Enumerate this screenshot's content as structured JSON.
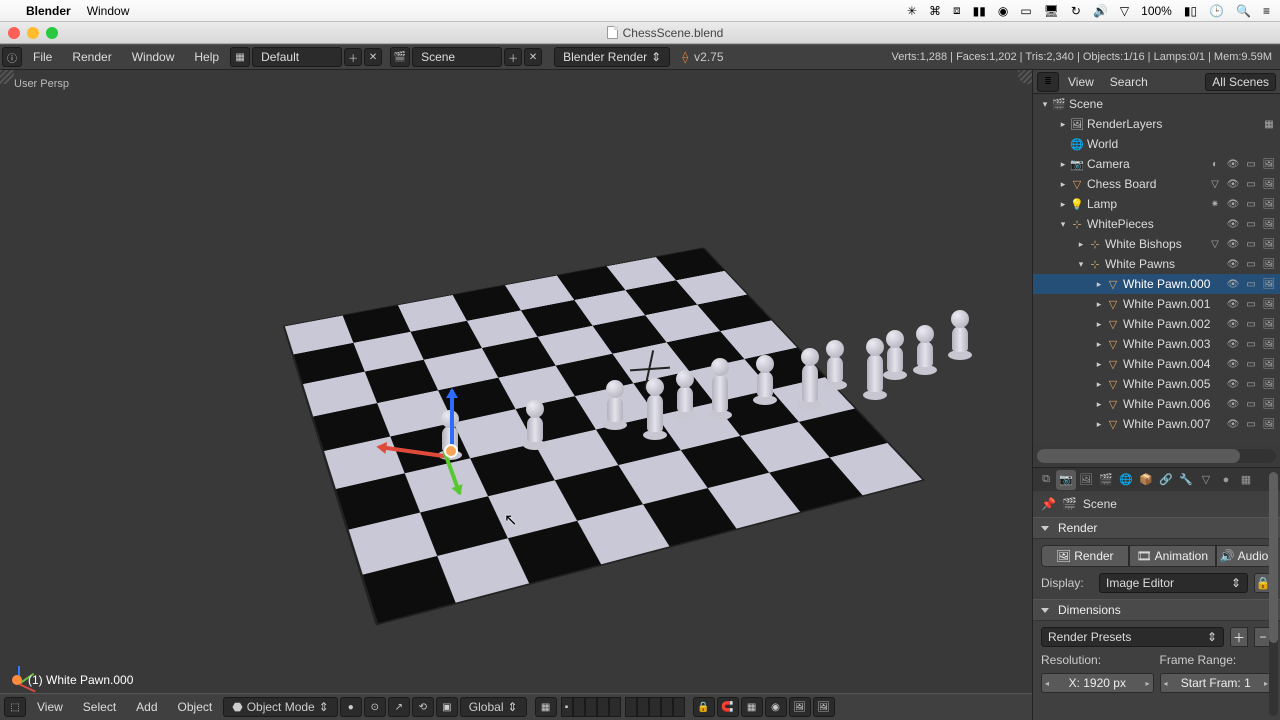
{
  "mac_menu": {
    "app": "Blender",
    "items": [
      "Window"
    ],
    "battery": "100%"
  },
  "window": {
    "title": "ChessScene.blend"
  },
  "info_bar": {
    "menus": [
      "File",
      "Render",
      "Window",
      "Help"
    ],
    "layout": "Default",
    "scene": "Scene",
    "engine": "Blender Render",
    "version": "v2.75",
    "stats": "Verts:1,288 | Faces:1,202 | Tris:2,340 | Objects:1/16 | Lamps:0/1 | Mem:9.59M"
  },
  "viewport": {
    "persp": "User Persp",
    "selected": "(1) White Pawn.000"
  },
  "v3d_header": {
    "menus": [
      "View",
      "Select",
      "Add",
      "Object"
    ],
    "mode": "Object Mode",
    "orient": "Global"
  },
  "outliner": {
    "header": {
      "view": "View",
      "search": "Search",
      "display": "All Scenes"
    },
    "tree": [
      {
        "depth": 0,
        "disc": "▾",
        "icon": "🎬",
        "cls": "i-scene",
        "name": "Scene",
        "r": []
      },
      {
        "depth": 1,
        "disc": "▸",
        "icon": "🖼",
        "cls": "i-scene",
        "name": "RenderLayers",
        "r": [
          "▦"
        ]
      },
      {
        "depth": 1,
        "disc": "",
        "icon": "🌐",
        "cls": "i-scene",
        "name": "World",
        "r": []
      },
      {
        "depth": 1,
        "disc": "▸",
        "icon": "📷",
        "cls": "i-cam",
        "name": "Camera",
        "r": [
          "◐",
          "👁",
          "▭",
          "🖼"
        ]
      },
      {
        "depth": 1,
        "disc": "▸",
        "icon": "▽",
        "cls": "i-obj",
        "name": "Chess Board",
        "r": [
          "▽",
          "👁",
          "▭",
          "🖼"
        ]
      },
      {
        "depth": 1,
        "disc": "▸",
        "icon": "💡",
        "cls": "i-lamp",
        "name": "Lamp",
        "r": [
          "✷",
          "👁",
          "▭",
          "🖼"
        ]
      },
      {
        "depth": 1,
        "disc": "▾",
        "icon": "⊹",
        "cls": "i-empty",
        "name": "WhitePieces",
        "r": [
          "👁",
          "▭",
          "🖼"
        ]
      },
      {
        "depth": 2,
        "disc": "▸",
        "icon": "⊹",
        "cls": "i-empty",
        "name": "White Bishops",
        "r": [
          "▽",
          "👁",
          "▭",
          "🖼"
        ]
      },
      {
        "depth": 2,
        "disc": "▾",
        "icon": "⊹",
        "cls": "i-empty",
        "name": "White Pawns",
        "r": [
          "👁",
          "▭",
          "🖼"
        ]
      },
      {
        "depth": 3,
        "disc": "▸",
        "icon": "▽",
        "cls": "i-obj",
        "name": "White Pawn.000",
        "r": [
          "👁",
          "▭",
          "🖼"
        ],
        "selected": true
      },
      {
        "depth": 3,
        "disc": "▸",
        "icon": "▽",
        "cls": "i-obj",
        "name": "White Pawn.001",
        "r": [
          "👁",
          "▭",
          "🖼"
        ]
      },
      {
        "depth": 3,
        "disc": "▸",
        "icon": "▽",
        "cls": "i-obj",
        "name": "White Pawn.002",
        "r": [
          "👁",
          "▭",
          "🖼"
        ]
      },
      {
        "depth": 3,
        "disc": "▸",
        "icon": "▽",
        "cls": "i-obj",
        "name": "White Pawn.003",
        "r": [
          "👁",
          "▭",
          "🖼"
        ]
      },
      {
        "depth": 3,
        "disc": "▸",
        "icon": "▽",
        "cls": "i-obj",
        "name": "White Pawn.004",
        "r": [
          "👁",
          "▭",
          "🖼"
        ]
      },
      {
        "depth": 3,
        "disc": "▸",
        "icon": "▽",
        "cls": "i-obj",
        "name": "White Pawn.005",
        "r": [
          "👁",
          "▭",
          "🖼"
        ]
      },
      {
        "depth": 3,
        "disc": "▸",
        "icon": "▽",
        "cls": "i-obj",
        "name": "White Pawn.006",
        "r": [
          "👁",
          "▭",
          "🖼"
        ]
      },
      {
        "depth": 3,
        "disc": "▸",
        "icon": "▽",
        "cls": "i-obj",
        "name": "White Pawn.007",
        "r": [
          "👁",
          "▭",
          "🖼"
        ]
      }
    ]
  },
  "props": {
    "breadcrumb": "Scene",
    "render_panel": "Render",
    "render_buttons": {
      "render": "Render",
      "animation": "Animation",
      "audio": "Audio"
    },
    "display_label": "Display:",
    "display_value": "Image Editor",
    "dimensions_panel": "Dimensions",
    "presets": "Render Presets",
    "resolution_label": "Resolution:",
    "frame_range_label": "Frame Range:",
    "res_x": "X: 1920 px",
    "start_frame": "Start Fram: 1"
  }
}
